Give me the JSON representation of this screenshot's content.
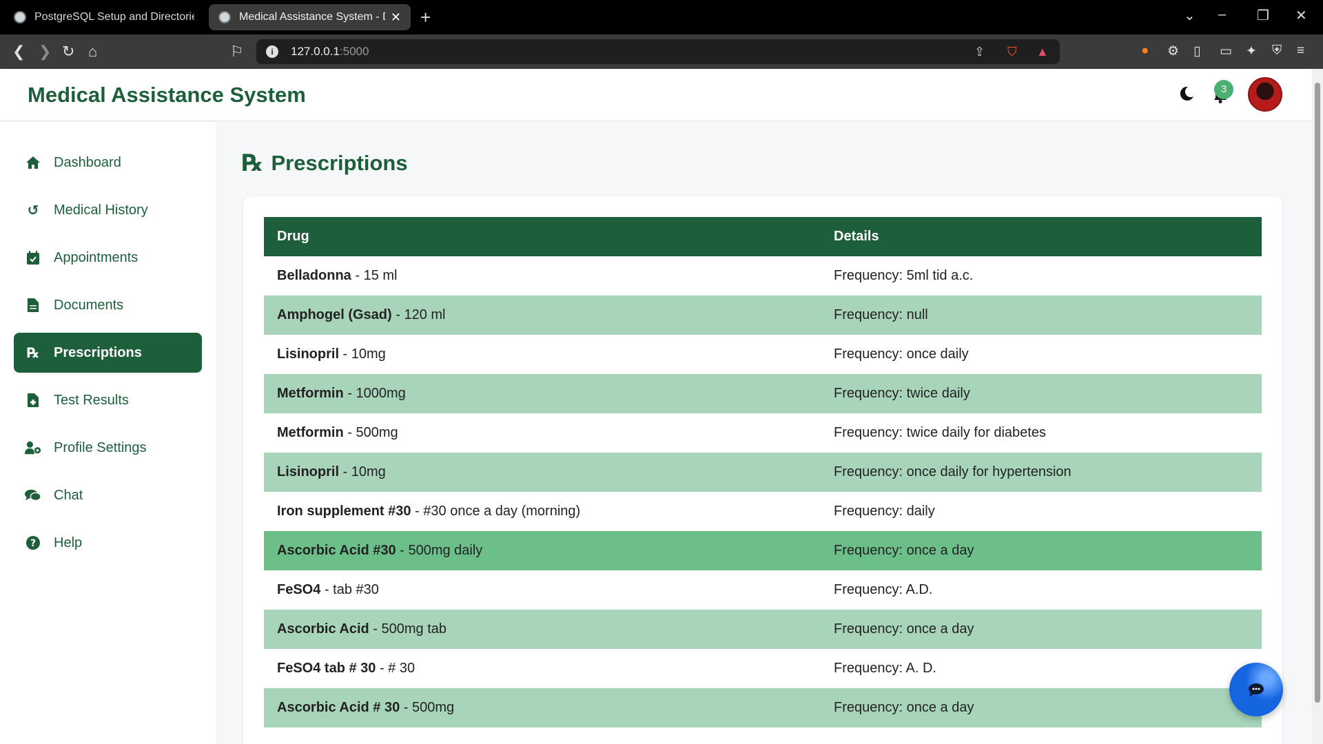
{
  "browser": {
    "tabs": [
      {
        "title": "PostgreSQL Setup and Directories"
      },
      {
        "title": "Medical Assistance System - Da"
      }
    ],
    "url_host": "127.0.0.1",
    "url_port": ":5000"
  },
  "header": {
    "title": "Medical Assistance System",
    "notification_count": "3"
  },
  "sidebar": {
    "items": [
      {
        "label": "Dashboard",
        "icon": "home-icon"
      },
      {
        "label": "Medical History",
        "icon": "history-icon"
      },
      {
        "label": "Appointments",
        "icon": "calendar-icon"
      },
      {
        "label": "Documents",
        "icon": "document-icon"
      },
      {
        "label": "Prescriptions",
        "icon": "prescription-icon",
        "active": true
      },
      {
        "label": "Test Results",
        "icon": "file-medical-icon"
      },
      {
        "label": "Profile Settings",
        "icon": "user-cog-icon"
      },
      {
        "label": "Chat",
        "icon": "comments-icon"
      },
      {
        "label": "Help",
        "icon": "question-icon"
      }
    ]
  },
  "main": {
    "title": "Prescriptions",
    "columns": [
      "Drug",
      "Details"
    ],
    "rows": [
      {
        "drug": "Belladonna",
        "dose": " - 15 ml",
        "details": "Frequency: 5ml tid a.c."
      },
      {
        "drug": "Amphogel (Gsad)",
        "dose": " - 120 ml",
        "details": "Frequency: null"
      },
      {
        "drug": "Lisinopril",
        "dose": " - 10mg",
        "details": "Frequency: once daily"
      },
      {
        "drug": "Metformin",
        "dose": " - 1000mg",
        "details": "Frequency: twice daily"
      },
      {
        "drug": "Metformin",
        "dose": " - 500mg",
        "details": "Frequency: twice daily for diabetes"
      },
      {
        "drug": "Lisinopril",
        "dose": " - 10mg",
        "details": "Frequency: once daily for hypertension"
      },
      {
        "drug": "Iron supplement #30",
        "dose": " - #30 once a day (morning)",
        "details": "Frequency: daily"
      },
      {
        "drug": "Ascorbic Acid #30",
        "dose": " - 500mg daily",
        "details": "Frequency: once a day"
      },
      {
        "drug": "FeSO4",
        "dose": " - tab #30",
        "details": "Frequency: A.D."
      },
      {
        "drug": "Ascorbic Acid",
        "dose": " - 500mg tab",
        "details": "Frequency: once a day"
      },
      {
        "drug": "FeSO4 tab # 30",
        "dose": " - # 30",
        "details": "Frequency: A. D."
      },
      {
        "drug": "Ascorbic Acid # 30",
        "dose": " - 500mg",
        "details": "Frequency: once a day"
      }
    ]
  },
  "colors": {
    "primary": "#1d5f3a",
    "row_alt": "#a8d5b9",
    "row_hover": "#6cbf88",
    "badge": "#4caf72",
    "fab": "#1565e0"
  }
}
